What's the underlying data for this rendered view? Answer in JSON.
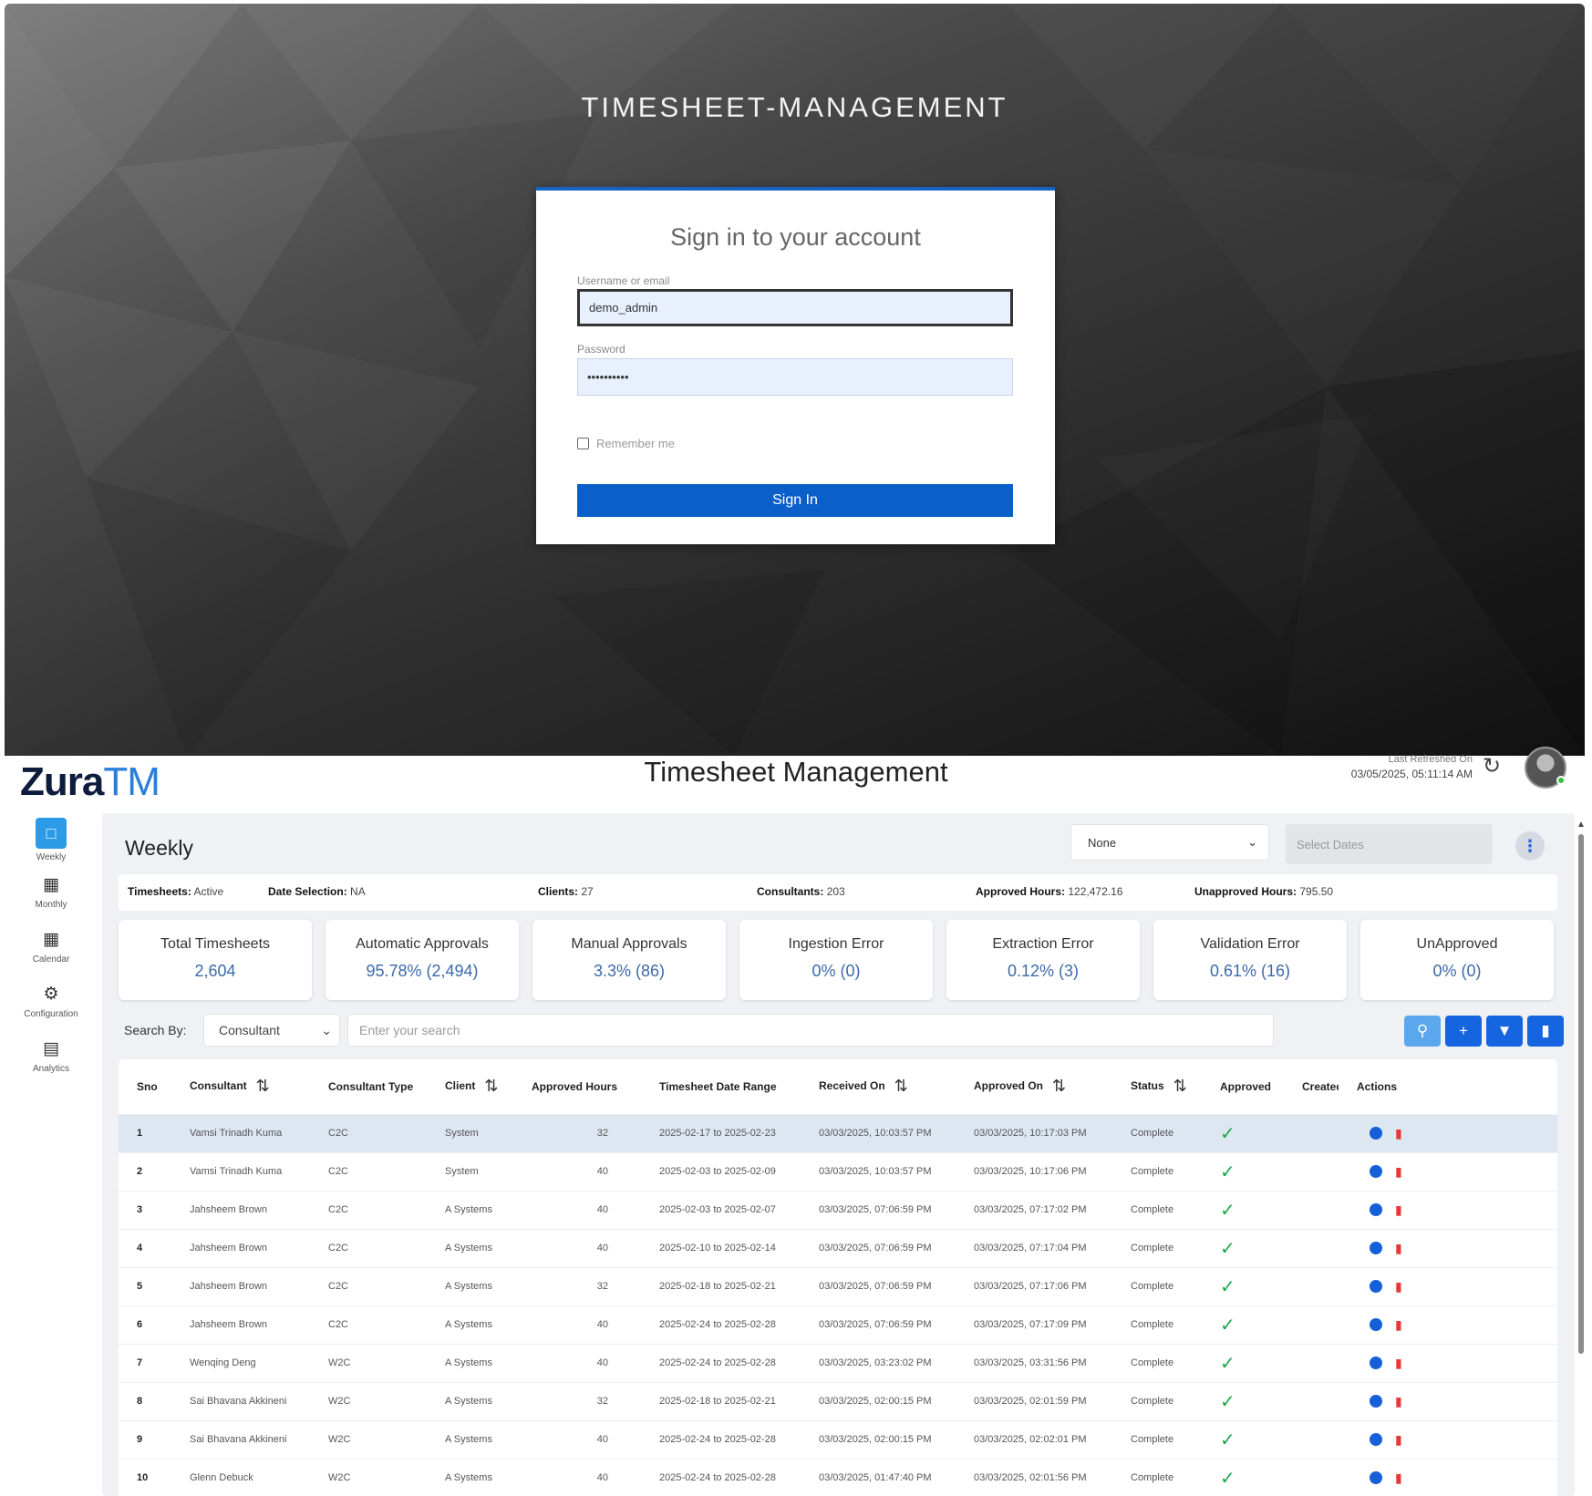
{
  "login": {
    "title": "TIMESHEET-MANAGEMENT",
    "card_title": "Sign in to your account",
    "username_label": "Username or email",
    "username_value": "demo_admin",
    "password_label": "Password",
    "password_value": "••••••••••",
    "remember_label": "Remember me",
    "signin_label": "Sign In",
    "accent_color": "#1565c0"
  },
  "header": {
    "logo_main": "Zura",
    "logo_suffix": "TM",
    "title": "Timesheet Management",
    "refresh_label": "Last Refreshed On",
    "refresh_time": "03/05/2025, 05:11:14 AM",
    "refresh_icon": "refresh-icon",
    "avatar_icon": "user-avatar"
  },
  "sidebar": {
    "items": [
      {
        "label": "Weekly",
        "icon": "weekly-icon",
        "active": true
      },
      {
        "label": "Monthly",
        "icon": "calendar-month-icon"
      },
      {
        "label": "Calendar",
        "icon": "calendar-icon"
      },
      {
        "label": "Configuration",
        "icon": "gear-icon"
      },
      {
        "label": "Analytics",
        "icon": "analytics-icon"
      }
    ]
  },
  "main": {
    "heading": "Weekly",
    "period_select": "None",
    "date_placeholder": "Select Dates"
  },
  "summary": {
    "timesheets_label": "Timesheets:",
    "timesheets_value": "Active",
    "date_label": "Date Selection:",
    "date_value": "NA",
    "clients_label": "Clients:",
    "clients_value": "27",
    "consultants_label": "Consultants:",
    "consultants_value": "203",
    "approved_label": "Approved Hours:",
    "approved_value": "122,472.16",
    "unapproved_label": "Unapproved Hours:",
    "unapproved_value": "795.50"
  },
  "kpis": [
    {
      "label": "Total Timesheets",
      "value": "2,604"
    },
    {
      "label": "Automatic Approvals",
      "value": "95.78% (2,494)"
    },
    {
      "label": "Manual Approvals",
      "value": "3.3% (86)"
    },
    {
      "label": "Ingestion Error",
      "value": "0% (0)"
    },
    {
      "label": "Extraction Error",
      "value": "0.12% (3)"
    },
    {
      "label": "Validation Error",
      "value": "0.61% (16)"
    },
    {
      "label": "UnApproved",
      "value": "0% (0)"
    }
  ],
  "search": {
    "label": "Search By:",
    "field": "Consultant",
    "placeholder": "Enter your search"
  },
  "table": {
    "columns": [
      "Sno",
      "Consultant",
      "Consultant Type",
      "Client",
      "Approved Hours",
      "Timesheet Date Range",
      "Received On",
      "Approved On",
      "Status",
      "Approved",
      "Created",
      "Actions"
    ],
    "rows": [
      {
        "sno": "1",
        "consultant": "Vamsi Trinadh Kuma",
        "type": "C2C",
        "client": "System",
        "hours": "32",
        "range": "2025-02-17 to 2025-02-23",
        "received": "03/03/2025, 10:03:57 PM",
        "approved_on": "03/03/2025, 10:17:03 PM",
        "status": "Complete"
      },
      {
        "sno": "2",
        "consultant": "Vamsi Trinadh Kuma",
        "type": "C2C",
        "client": "System",
        "hours": "40",
        "range": "2025-02-03 to 2025-02-09",
        "received": "03/03/2025, 10:03:57 PM",
        "approved_on": "03/03/2025, 10:17:06 PM",
        "status": "Complete"
      },
      {
        "sno": "3",
        "consultant": "Jahsheem Brown",
        "type": "C2C",
        "client": "A Systems",
        "hours": "40",
        "range": "2025-02-03 to 2025-02-07",
        "received": "03/03/2025, 07:06:59 PM",
        "approved_on": "03/03/2025, 07:17:02 PM",
        "status": "Complete"
      },
      {
        "sno": "4",
        "consultant": "Jahsheem Brown",
        "type": "C2C",
        "client": "A Systems",
        "hours": "40",
        "range": "2025-02-10 to 2025-02-14",
        "received": "03/03/2025, 07:06:59 PM",
        "approved_on": "03/03/2025, 07:17:04 PM",
        "status": "Complete"
      },
      {
        "sno": "5",
        "consultant": "Jahsheem Brown",
        "type": "C2C",
        "client": "A Systems",
        "hours": "32",
        "range": "2025-02-18 to 2025-02-21",
        "received": "03/03/2025, 07:06:59 PM",
        "approved_on": "03/03/2025, 07:17:06 PM",
        "status": "Complete"
      },
      {
        "sno": "6",
        "consultant": "Jahsheem Brown",
        "type": "C2C",
        "client": "A Systems",
        "hours": "40",
        "range": "2025-02-24 to 2025-02-28",
        "received": "03/03/2025, 07:06:59 PM",
        "approved_on": "03/03/2025, 07:17:09 PM",
        "status": "Complete"
      },
      {
        "sno": "7",
        "consultant": "Wenqing Deng",
        "type": "W2C",
        "client": "A Systems",
        "hours": "40",
        "range": "2025-02-24 to 2025-02-28",
        "received": "03/03/2025, 03:23:02 PM",
        "approved_on": "03/03/2025, 03:31:56 PM",
        "status": "Complete"
      },
      {
        "sno": "8",
        "consultant": "Sai Bhavana Akkineni",
        "type": "W2C",
        "client": "A Systems",
        "hours": "32",
        "range": "2025-02-18 to 2025-02-21",
        "received": "03/03/2025, 02:00:15 PM",
        "approved_on": "03/03/2025, 02:01:59 PM",
        "status": "Complete"
      },
      {
        "sno": "9",
        "consultant": "Sai Bhavana Akkineni",
        "type": "W2C",
        "client": "A Systems",
        "hours": "40",
        "range": "2025-02-24 to 2025-02-28",
        "received": "03/03/2025, 02:00:15 PM",
        "approved_on": "03/03/2025, 02:02:01 PM",
        "status": "Complete"
      },
      {
        "sno": "10",
        "consultant": "Glenn Debuck",
        "type": "W2C",
        "client": "A Systems",
        "hours": "40",
        "range": "2025-02-24 to 2025-02-28",
        "received": "03/03/2025, 01:47:40 PM",
        "approved_on": "03/03/2025, 02:01:56 PM",
        "status": "Complete"
      }
    ]
  }
}
